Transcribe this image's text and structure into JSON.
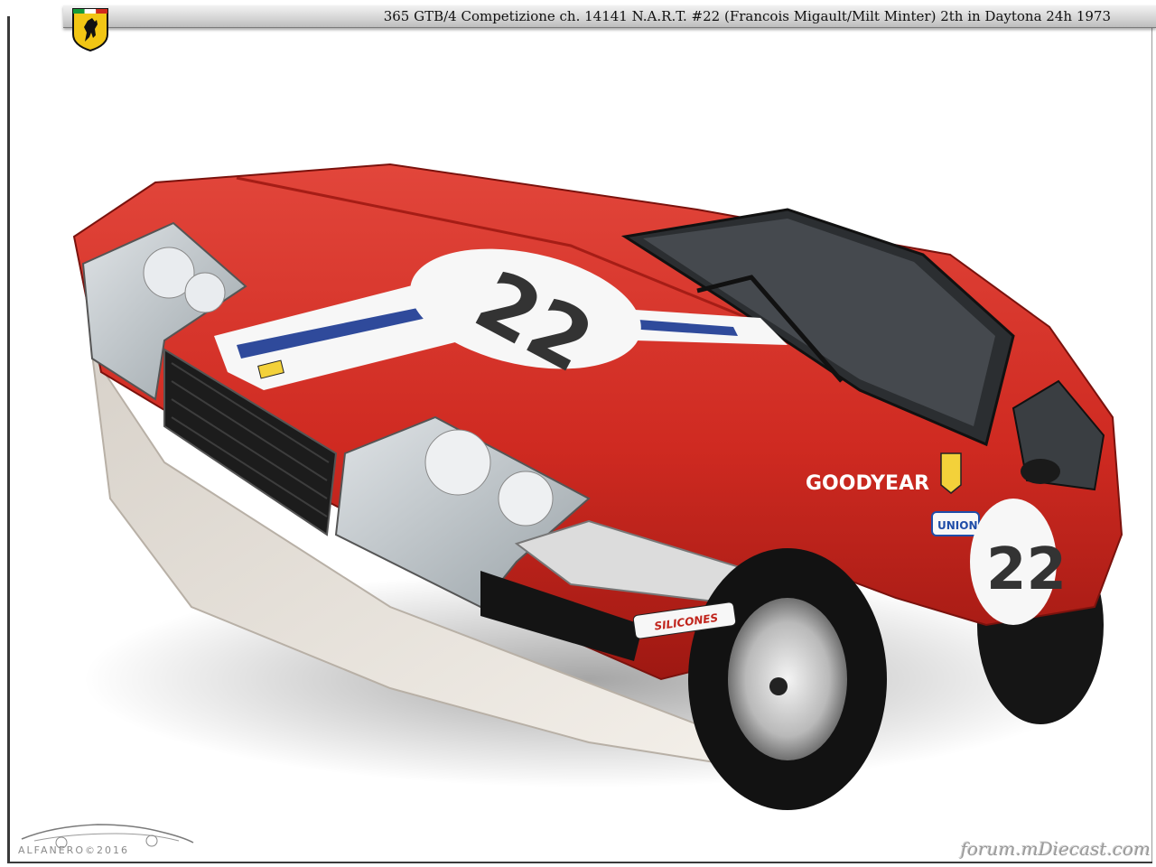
{
  "header": {
    "title": "365 GTB/4 Competizione  ch. 14141  N.A.R.T.  #22 (Francois Migault/Milt Minter)  2th in Daytona 24h 1973"
  },
  "car": {
    "number": "22",
    "decals": {
      "goodyear": "GOODYEAR",
      "union": "UNION",
      "silicones": "SILICONES"
    }
  },
  "footer": {
    "left_logo_text": "ALFANERO©2016",
    "watermark": "forum.mDiecast.com"
  }
}
